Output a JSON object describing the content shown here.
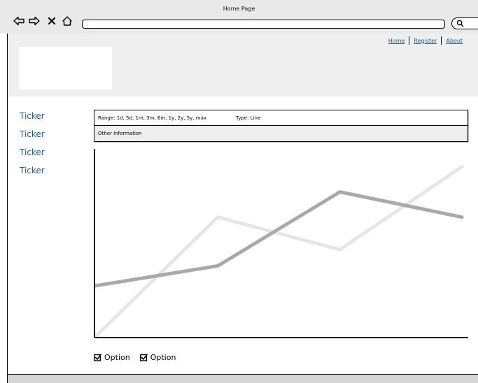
{
  "browser": {
    "title": "Home Page",
    "icons": [
      "back-arrow-icon",
      "forward-arrow-icon",
      "close-icon",
      "home-icon",
      "search-icon"
    ]
  },
  "nav": {
    "links": [
      "Home",
      "Register",
      "About"
    ]
  },
  "sidebar": {
    "items": [
      {
        "label": "Ticker"
      },
      {
        "label": "Ticker"
      },
      {
        "label": "Ticker"
      },
      {
        "label": "Ticker"
      }
    ]
  },
  "info": {
    "range": "Range: 1d, 5d, 1m, 3m, 6m, 1y, 2y, 5y, max",
    "type": "Type: Line",
    "other": "Other Information"
  },
  "chart_data": {
    "type": "line",
    "x": [
      0,
      1,
      2,
      3
    ],
    "series": [
      {
        "values": [
          0,
          6.6,
          4.8,
          9.4
        ],
        "color": "#e6e6e6"
      },
      {
        "values": [
          2.8,
          3.9,
          8.0,
          6.6
        ],
        "color": "#a9a9a9"
      }
    ],
    "xlim": [
      0,
      3
    ],
    "ylim": [
      0,
      10
    ],
    "grid": false
  },
  "options": [
    {
      "label": "Option",
      "checked": true
    },
    {
      "label": "Option",
      "checked": true
    }
  ],
  "colors": {
    "link": "#1a5ea8",
    "chrome": "#e9e9e9",
    "header": "#efefef"
  }
}
